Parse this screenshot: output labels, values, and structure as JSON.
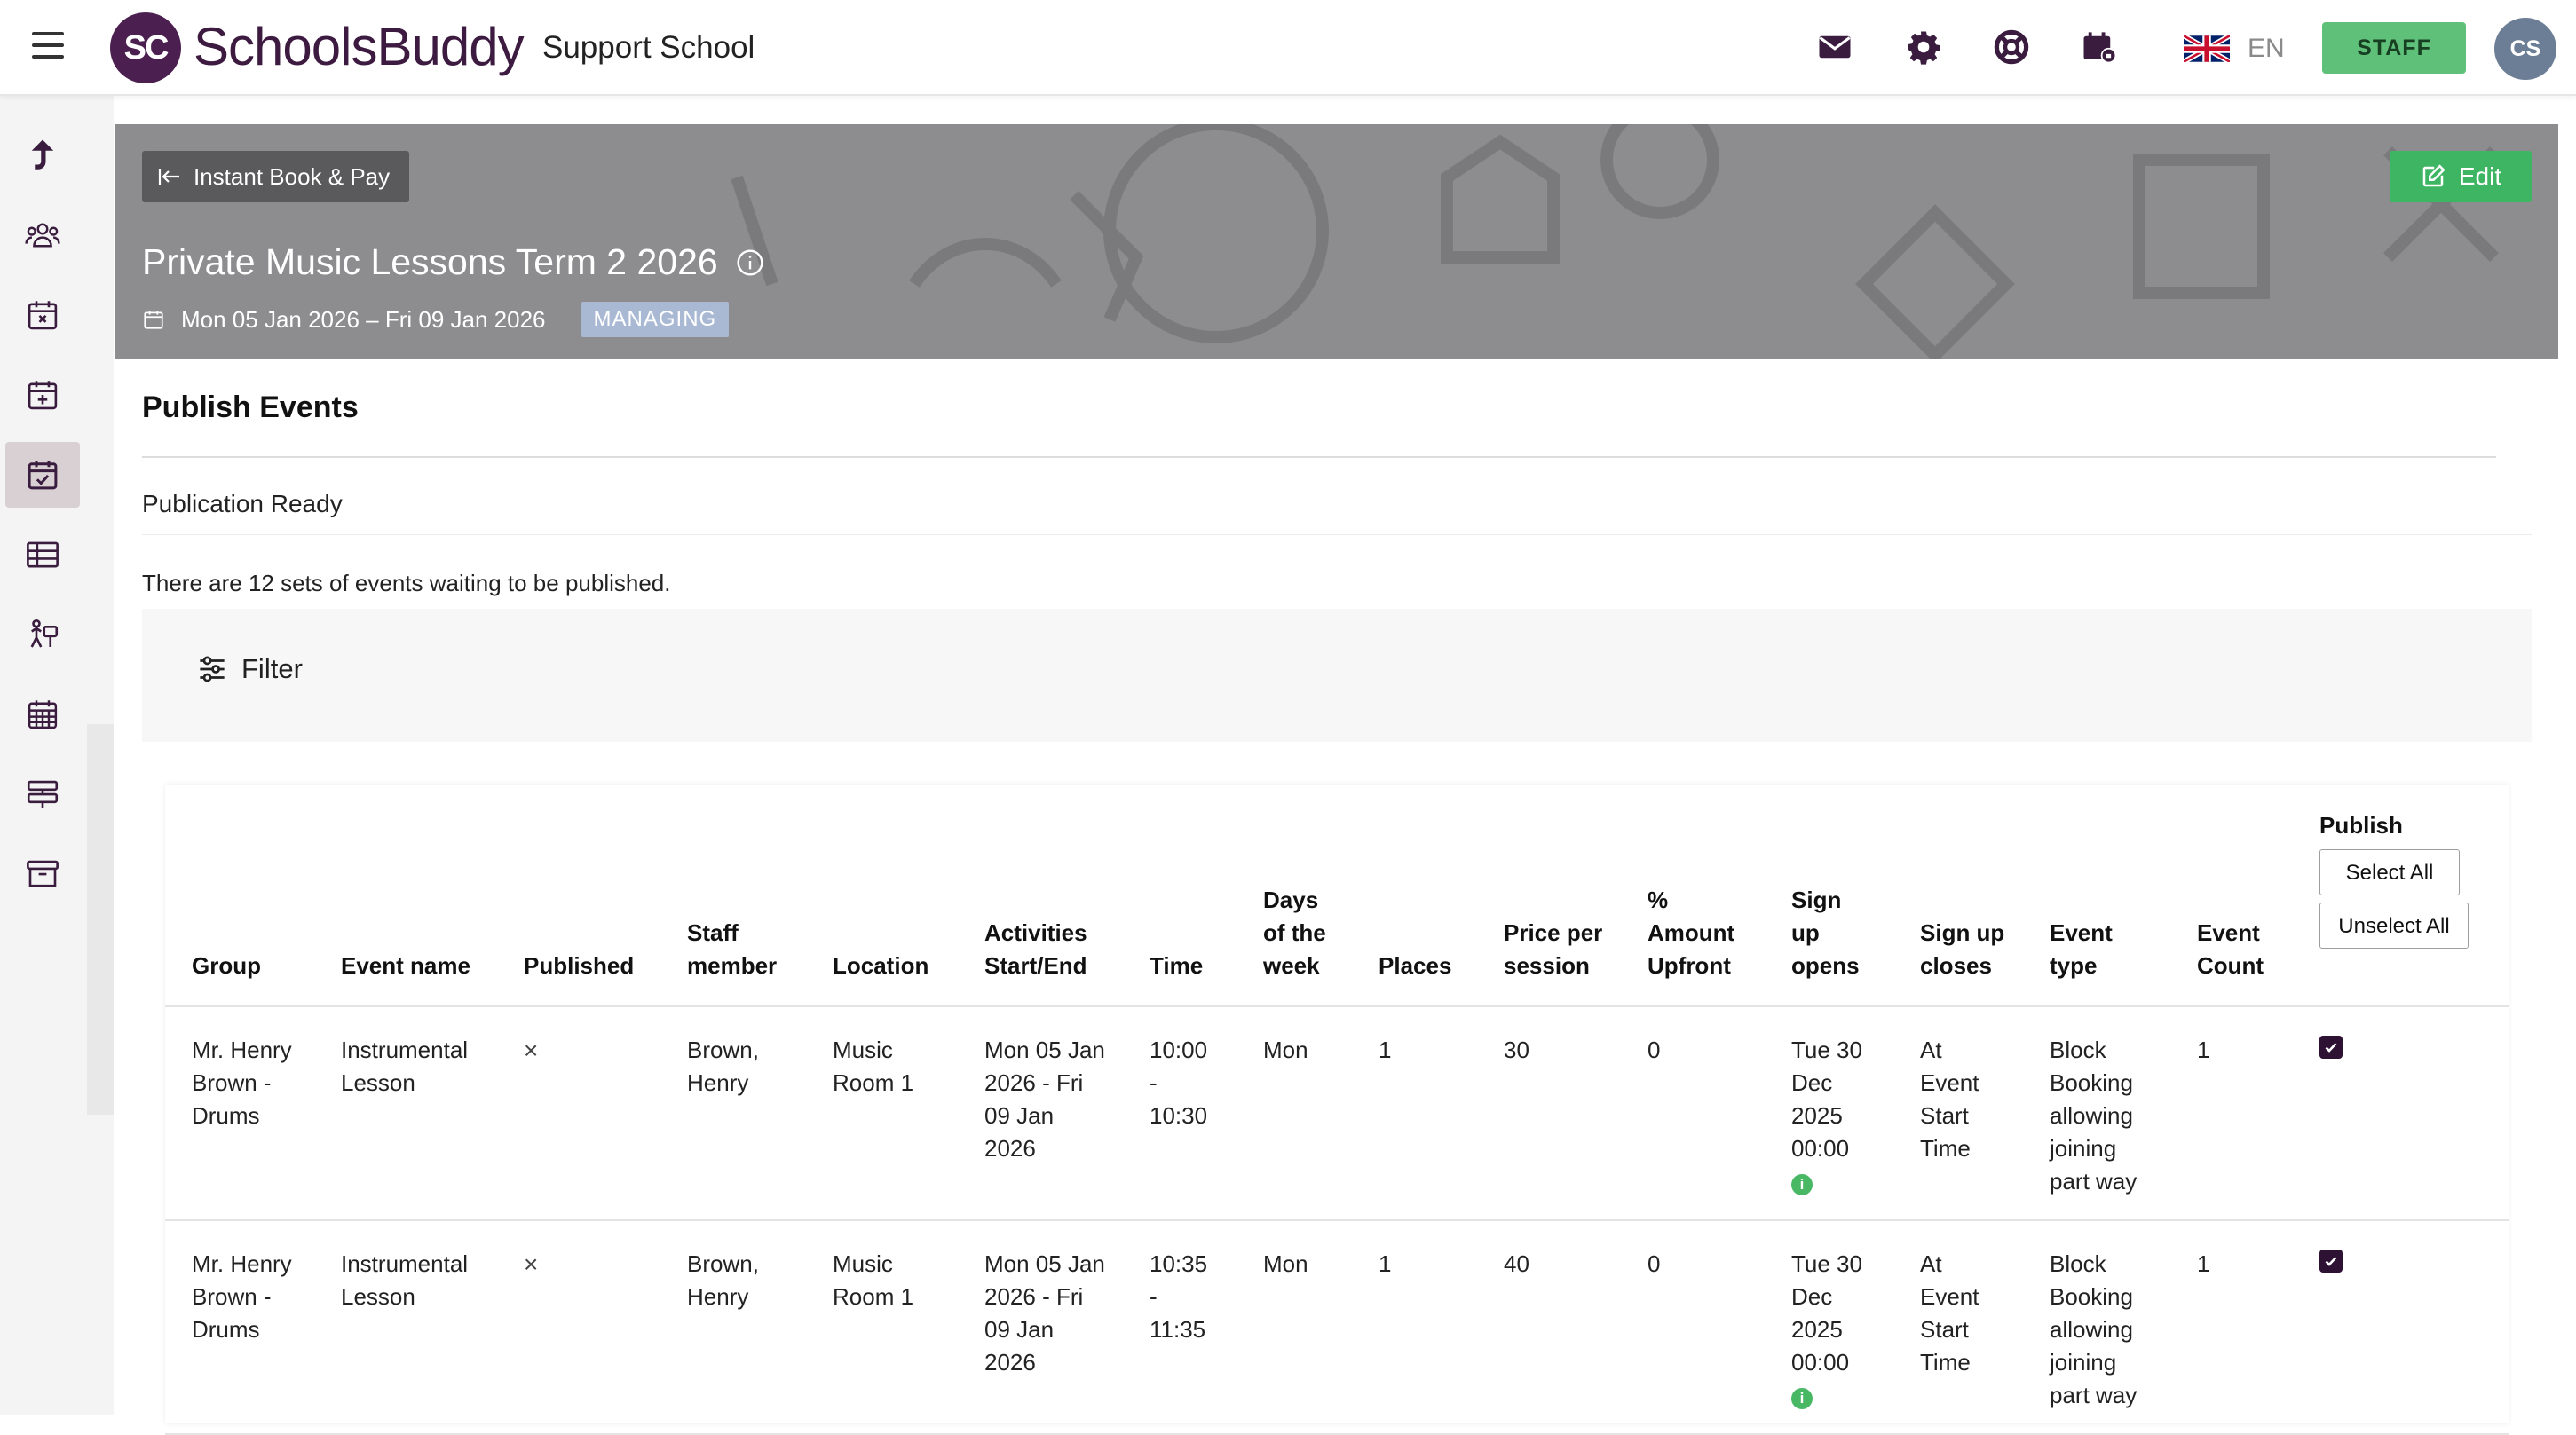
{
  "header": {
    "logo_text": "SchoolsBuddy",
    "logo_initials": "SC",
    "school_name": "Support School",
    "language": "EN",
    "staff_label": "STAFF",
    "avatar_initials": "CS"
  },
  "banner": {
    "back_label": "Instant Book & Pay",
    "edit_label": "Edit",
    "title": "Private Music Lessons Term 2 2026",
    "dates": "Mon 05 Jan 2026 – Fri 09 Jan 2026",
    "badge": "MANAGING"
  },
  "main": {
    "section_title": "Publish Events",
    "publication_ready": "Publication Ready",
    "waiting_text": "There are 12 sets of events waiting to be published.",
    "filter_label": "Filter"
  },
  "table": {
    "headers": {
      "group": "Group",
      "event_name": "Event name",
      "published": "Published",
      "staff_member": "Staff member",
      "location": "Location",
      "activities": "Activities Start/End",
      "time": "Time",
      "days": "Days of the week",
      "places": "Places",
      "price": "Price per session",
      "amount_upfront": "% Amount Upfront",
      "signup_opens": "Sign up opens",
      "signup_closes": "Sign up closes",
      "event_type": "Event type",
      "event_count": "Event Count",
      "publish": "Publish"
    },
    "select_all": "Select All",
    "unselect_all": "Unselect All",
    "rows": [
      {
        "group": "Mr. Henry Brown - Drums",
        "event_name": "Instrumental Lesson",
        "published": "×",
        "staff_member": "Brown, Henry",
        "location": "Music Room 1",
        "activities": "Mon 05 Jan 2026 - Fri 09 Jan 2026",
        "time": "10:00 - 10:30",
        "days": "Mon",
        "places": "1",
        "price": "30",
        "amount_upfront": "0",
        "signup_opens": "Tue 30 Dec 2025 00:00",
        "signup_closes": "At Event Start Time",
        "event_type": "Block Booking allowing joining part way",
        "event_count": "1",
        "publish_checked": true
      },
      {
        "group": "Mr. Henry Brown - Drums",
        "event_name": "Instrumental Lesson",
        "published": "×",
        "staff_member": "Brown, Henry",
        "location": "Music Room 1",
        "activities": "Mon 05 Jan 2026 - Fri 09 Jan 2026",
        "time": "10:35 - 11:35",
        "days": "Mon",
        "places": "1",
        "price": "40",
        "amount_upfront": "0",
        "signup_opens": "Tue 30 Dec 2025 00:00",
        "signup_closes": "At Event Start Time",
        "event_type": "Block Booking allowing joining part way",
        "event_count": "1",
        "publish_checked": true
      }
    ]
  },
  "colors": {
    "brand": "#4b1f4f",
    "staff_green": "#5fc07a",
    "edit_green": "#3db563",
    "banner_grey": "#8d8d8f",
    "badge_blue": "#a9b9d3"
  },
  "icons": {
    "topbar": [
      "mail-icon",
      "gear-icon",
      "lifebuoy-icon",
      "calendar-lock-icon",
      "uk-flag-icon"
    ],
    "sidebar": [
      "exit-arrow-icon",
      "people-icon",
      "calendar-x-icon",
      "calendar-plus-icon",
      "calendar-check-icon",
      "table-icon",
      "activity-person-icon",
      "calendar-grid-icon",
      "signpost-icon",
      "archive-icon"
    ]
  }
}
